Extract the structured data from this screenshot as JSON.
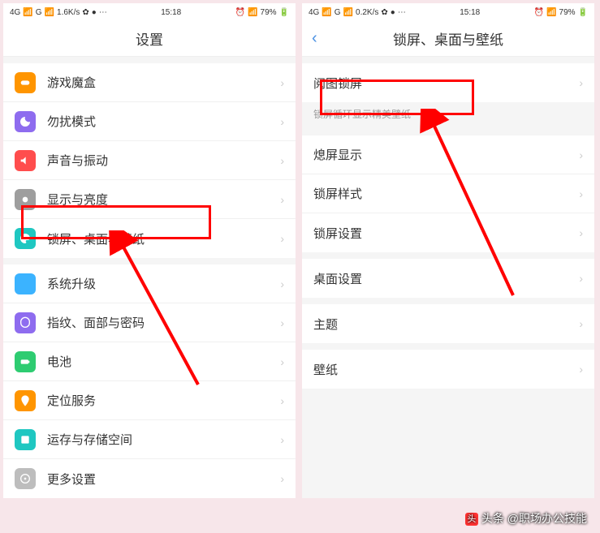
{
  "left": {
    "status": {
      "net": "4G",
      "carrier": "G",
      "speed": "1.6K/s",
      "time": "15:18",
      "battery": "79%"
    },
    "title": "设置",
    "group1": [
      {
        "label": "游戏魔盒",
        "icon": "game-icon",
        "color": "#ff9500"
      },
      {
        "label": "勿扰模式",
        "icon": "moon-icon",
        "color": "#8e6cef"
      },
      {
        "label": "声音与振动",
        "icon": "sound-icon",
        "color": "#ff4d4d"
      },
      {
        "label": "显示与亮度",
        "icon": "brightness-icon",
        "color": "#9e9e9e"
      },
      {
        "label": "锁屏、桌面与壁纸",
        "icon": "palette-icon",
        "color": "#1fc7c1"
      }
    ],
    "group2": [
      {
        "label": "系统升级",
        "icon": "update-icon",
        "color": "#3bb3ff"
      },
      {
        "label": "指纹、面部与密码",
        "icon": "fingerprint-icon",
        "color": "#8e6cef"
      },
      {
        "label": "电池",
        "icon": "battery-icon",
        "color": "#2ecc71"
      },
      {
        "label": "定位服务",
        "icon": "location-icon",
        "color": "#ff9500"
      },
      {
        "label": "运存与存储空间",
        "icon": "storage-icon",
        "color": "#1fc7c1"
      },
      {
        "label": "更多设置",
        "icon": "more-icon",
        "color": "#bdbdbd"
      }
    ]
  },
  "right": {
    "status": {
      "net": "4G",
      "carrier": "G",
      "speed": "0.2K/s",
      "time": "15:18",
      "battery": "79%"
    },
    "title": "锁屏、桌面与壁纸",
    "group1": [
      {
        "label": "阅图锁屏"
      }
    ],
    "caption1": "锁屏循环显示精美壁纸",
    "group2": [
      {
        "label": "熄屏显示"
      },
      {
        "label": "锁屏样式"
      },
      {
        "label": "锁屏设置"
      }
    ],
    "group3": [
      {
        "label": "桌面设置"
      }
    ],
    "group4": [
      {
        "label": "主题"
      }
    ],
    "group5": [
      {
        "label": "壁纸"
      }
    ]
  },
  "watermark": "头条 @职场办公技能"
}
